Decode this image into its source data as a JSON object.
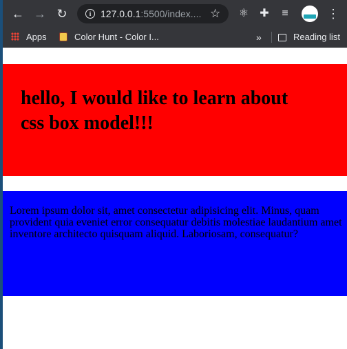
{
  "browser": {
    "url_host": "127.0.0.1",
    "url_rest": ":5500/index....",
    "bookmarks": {
      "apps_label": "Apps",
      "colorhunt_label": "Color Hunt - Color I...",
      "more_label": "»",
      "reading_list_label": "Reading list"
    }
  },
  "page": {
    "heading": "hello, I would like to learn about css box model!!!",
    "paragraph": "Lorem ipsum dolor sit, amet consectetur adipisicing elit. Minus, quam provident quia eveniet error consequatur debitis molestiae laudantium amet inventore architecto quisquam aliquid. Laboriosam, consequatur?",
    "colors": {
      "heading_box": "#ff0000",
      "paragraph_box": "#0000ff"
    }
  }
}
